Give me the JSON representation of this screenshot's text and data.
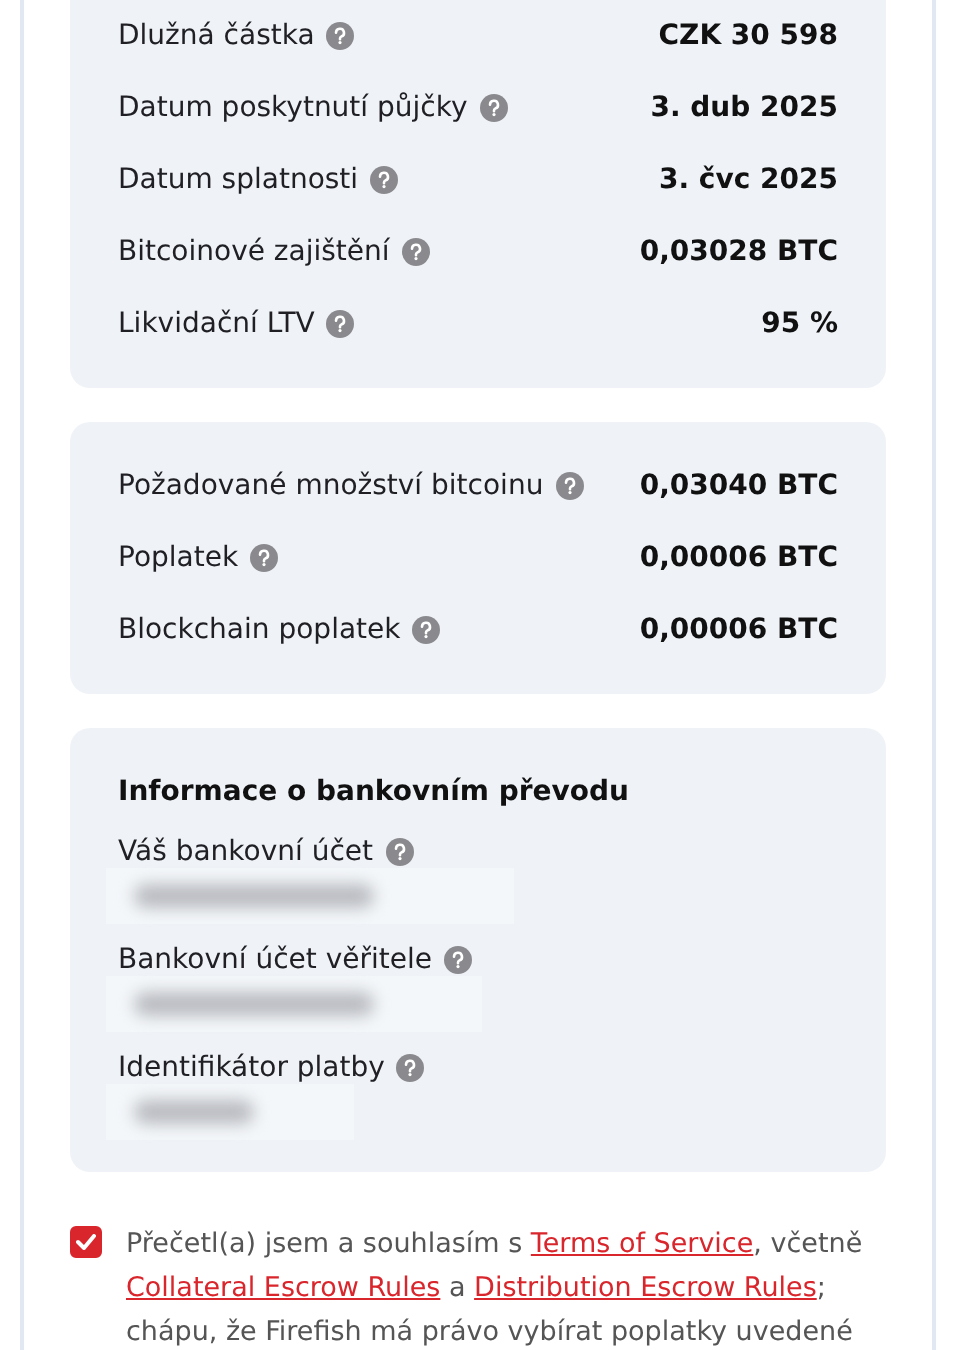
{
  "loan_summary": [
    {
      "label": "Dlužná částka",
      "value": "CZK 30 598"
    },
    {
      "label": "Datum poskytnutí půjčky",
      "value": "3. dub 2025"
    },
    {
      "label": "Datum splatnosti",
      "value": "3. čvc 2025"
    },
    {
      "label": "Bitcoinové zajištění",
      "value": "0,03028 BTC"
    },
    {
      "label": "Likvidační LTV",
      "value": "95 %"
    }
  ],
  "fees": [
    {
      "label": "Požadované množství bitcoinu",
      "value": "0,03040 BTC"
    },
    {
      "label": "Poplatek",
      "value": "0,00006 BTC"
    },
    {
      "label": "Blockchain poplatek",
      "value": "0,00006 BTC"
    }
  ],
  "bank_transfer": {
    "title": "Informace o bankovním převodu",
    "fields": [
      {
        "label": "Váš bankovní účet",
        "value_blurred": true
      },
      {
        "label": "Bankovní účet věřitele",
        "value_blurred": true
      },
      {
        "label": "Identifikátor platby",
        "value_blurred": true
      }
    ]
  },
  "consent": {
    "checked": true,
    "parts": [
      {
        "kind": "text",
        "text": "Přečetl(a) jsem a souhlasím s "
      },
      {
        "kind": "link",
        "text": "Terms of Service"
      },
      {
        "kind": "text",
        "text": ", včetně "
      },
      {
        "kind": "link",
        "text": "Collateral Escrow Rules"
      },
      {
        "kind": "text",
        "text": " a "
      },
      {
        "kind": "link",
        "text": "Distribution Escrow Rules"
      },
      {
        "kind": "text",
        "text": "; chápu, že Firefish má právo vybírat poplatky uvedené"
      }
    ]
  }
}
